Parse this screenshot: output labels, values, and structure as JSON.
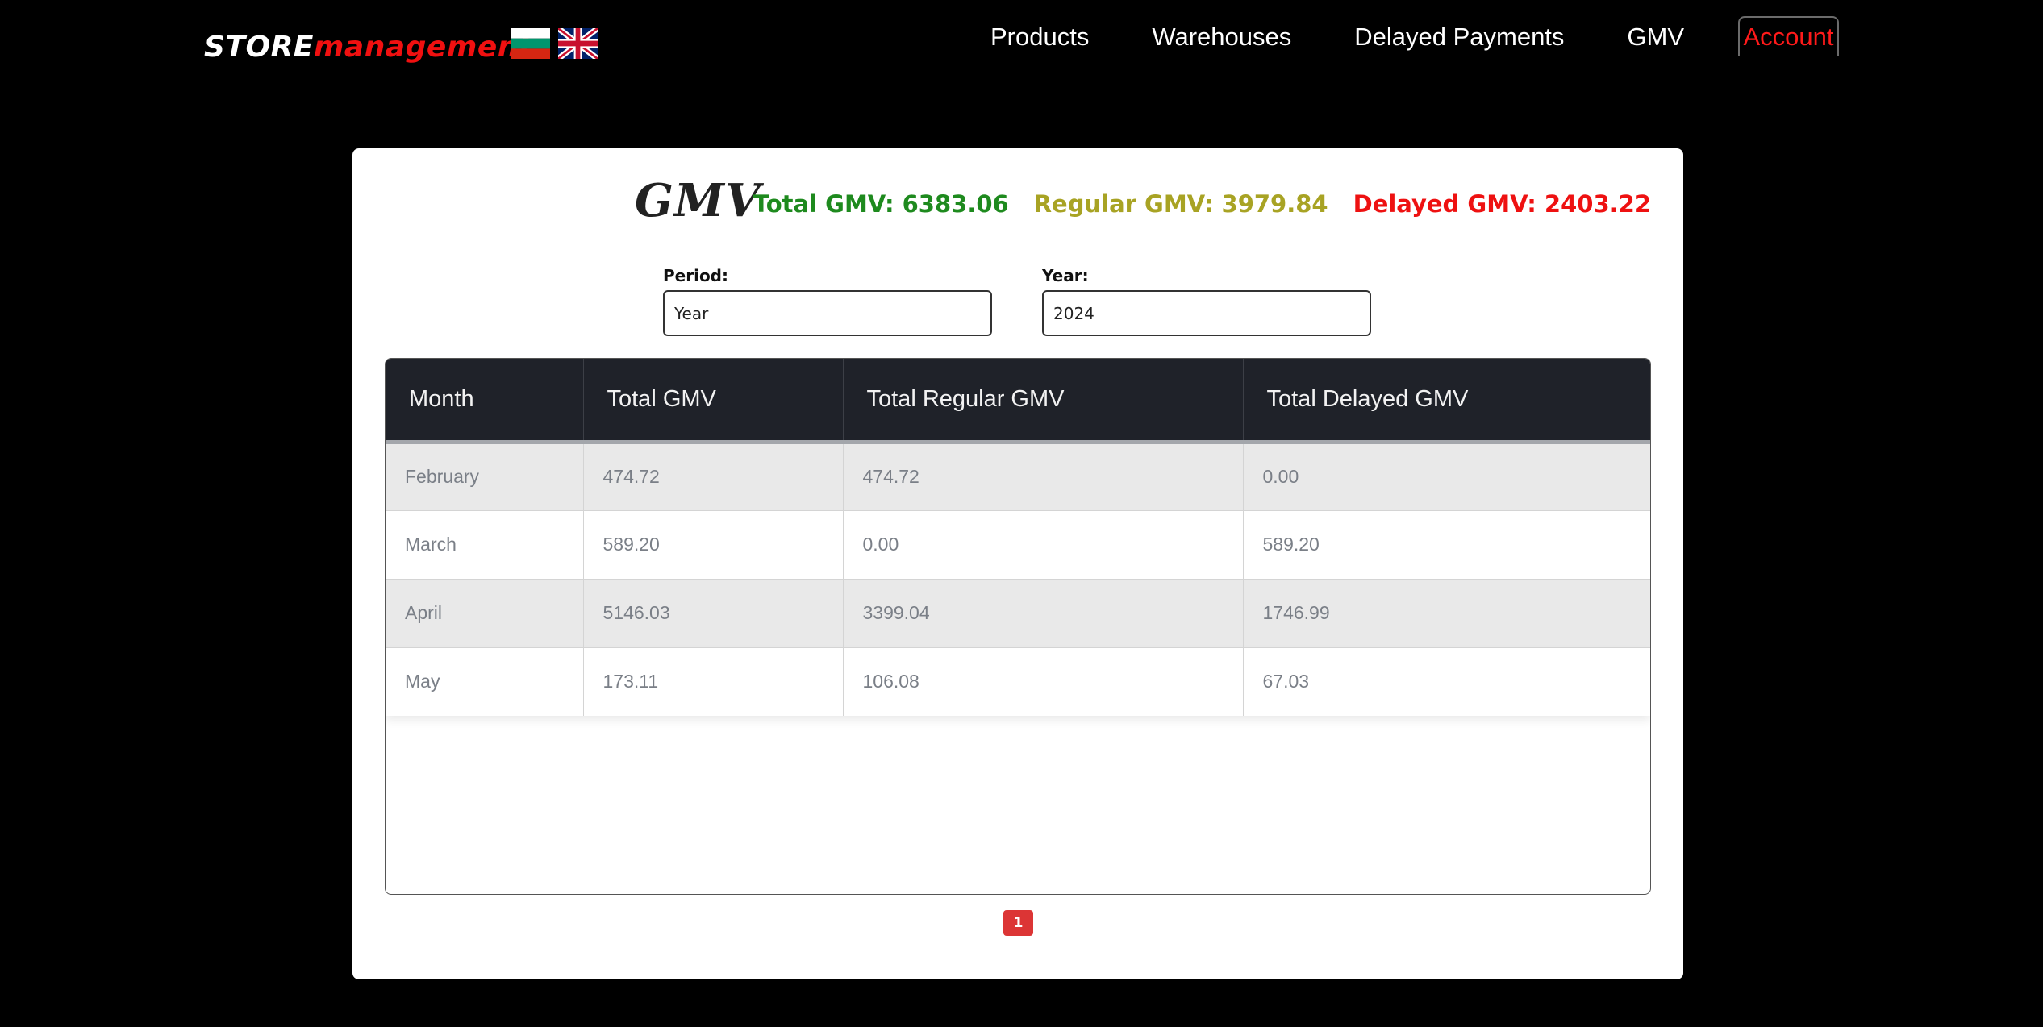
{
  "brand": {
    "part1": "STORE",
    "part2": "management"
  },
  "flags": [
    {
      "icon": "bulgaria-flag-icon",
      "colors": [
        "#ffffff",
        "#00966e",
        "#d62612"
      ]
    },
    {
      "icon": "uk-flag-icon",
      "colors": [
        "#012169",
        "#ffffff",
        "#c8102e"
      ]
    }
  ],
  "nav": {
    "items": [
      "Products",
      "Warehouses",
      "Delayed Payments",
      "GMV"
    ],
    "account": "Account"
  },
  "page": {
    "title": "GMV",
    "summary": {
      "total": "Total GMV: 6383.06",
      "regular": "Regular GMV: 3979.84",
      "delayed": "Delayed GMV: 2403.22"
    }
  },
  "filters": {
    "period": {
      "label": "Period:",
      "value": "Year"
    },
    "year": {
      "label": "Year:",
      "value": "2024"
    }
  },
  "table": {
    "headers": [
      "Month",
      "Total GMV",
      "Total Regular GMV",
      "Total Delayed GMV"
    ],
    "rows": [
      [
        "February",
        "474.72",
        "474.72",
        "0.00"
      ],
      [
        "March",
        "589.20",
        "0.00",
        "589.20"
      ],
      [
        "April",
        "5146.03",
        "3399.04",
        "1746.99"
      ],
      [
        "May",
        "173.11",
        "106.08",
        "67.03"
      ]
    ]
  },
  "pagination": {
    "current": "1"
  },
  "colors": {
    "total": "#1e8a1e",
    "regular": "#a8a324",
    "delayed": "#ee1111",
    "accent": "#dc3535"
  }
}
